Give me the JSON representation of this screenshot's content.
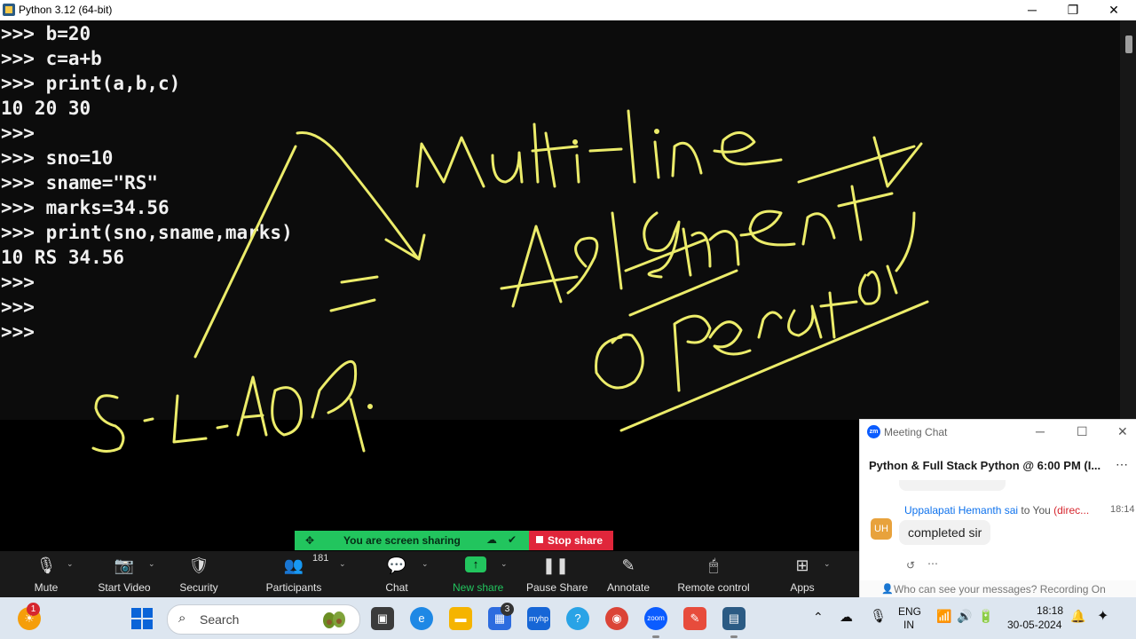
{
  "window": {
    "title": "Python 3.12 (64-bit)",
    "minimize_glyph": "─",
    "maximize_glyph": "❐",
    "close_glyph": "✕"
  },
  "console": {
    "lines": [
      ">>> b=20",
      ">>> c=a+b",
      ">>> print(a,b,c)",
      "10 20 30",
      ">>>",
      ">>> sno=10",
      ">>> sname=\"RS\"",
      ">>> marks=34.56",
      ">>> print(sno,sname,marks)",
      "10 RS 34.56",
      ">>>",
      ">>>",
      ">>>"
    ]
  },
  "annotation": {
    "ink_color": "#ecec6a"
  },
  "share_banner": {
    "text": "You are screen sharing",
    "stop_label": "Stop share"
  },
  "toolbar": {
    "items": [
      {
        "label": "Mute",
        "icon": "microphone-icon"
      },
      {
        "label": "Start Video",
        "icon": "video-off-icon"
      },
      {
        "label": "Security",
        "icon": "shield-icon"
      },
      {
        "label": "Participants",
        "icon": "participants-icon",
        "count": "181"
      },
      {
        "label": "Chat",
        "icon": "chat-icon"
      },
      {
        "label": "New share",
        "icon": "share-arrow-icon"
      },
      {
        "label": "Pause Share",
        "icon": "pause-icon"
      },
      {
        "label": "Annotate",
        "icon": "pen-icon"
      },
      {
        "label": "Remote control",
        "icon": "mouse-icon"
      },
      {
        "label": "Apps",
        "icon": "apps-icon"
      }
    ],
    "accent": "#22c55e"
  },
  "chat": {
    "window_title": "Meeting Chat",
    "meeting_title": "Python & Full Stack Python @ 6:00 PM (I...",
    "message": {
      "avatar": "UH",
      "sender": "Uppalapati Hemanth sai",
      "to": "to You",
      "direct": "(direc...",
      "time": "18:14",
      "text": "completed sir"
    },
    "footer": "Who can see your messages? Recording On"
  },
  "taskbar": {
    "search_placeholder": "Search",
    "notification_count": "1",
    "store_badge": "3",
    "lang_line1": "ENG",
    "lang_line2": "IN",
    "time": "18:18",
    "date": "30-05-2024"
  }
}
